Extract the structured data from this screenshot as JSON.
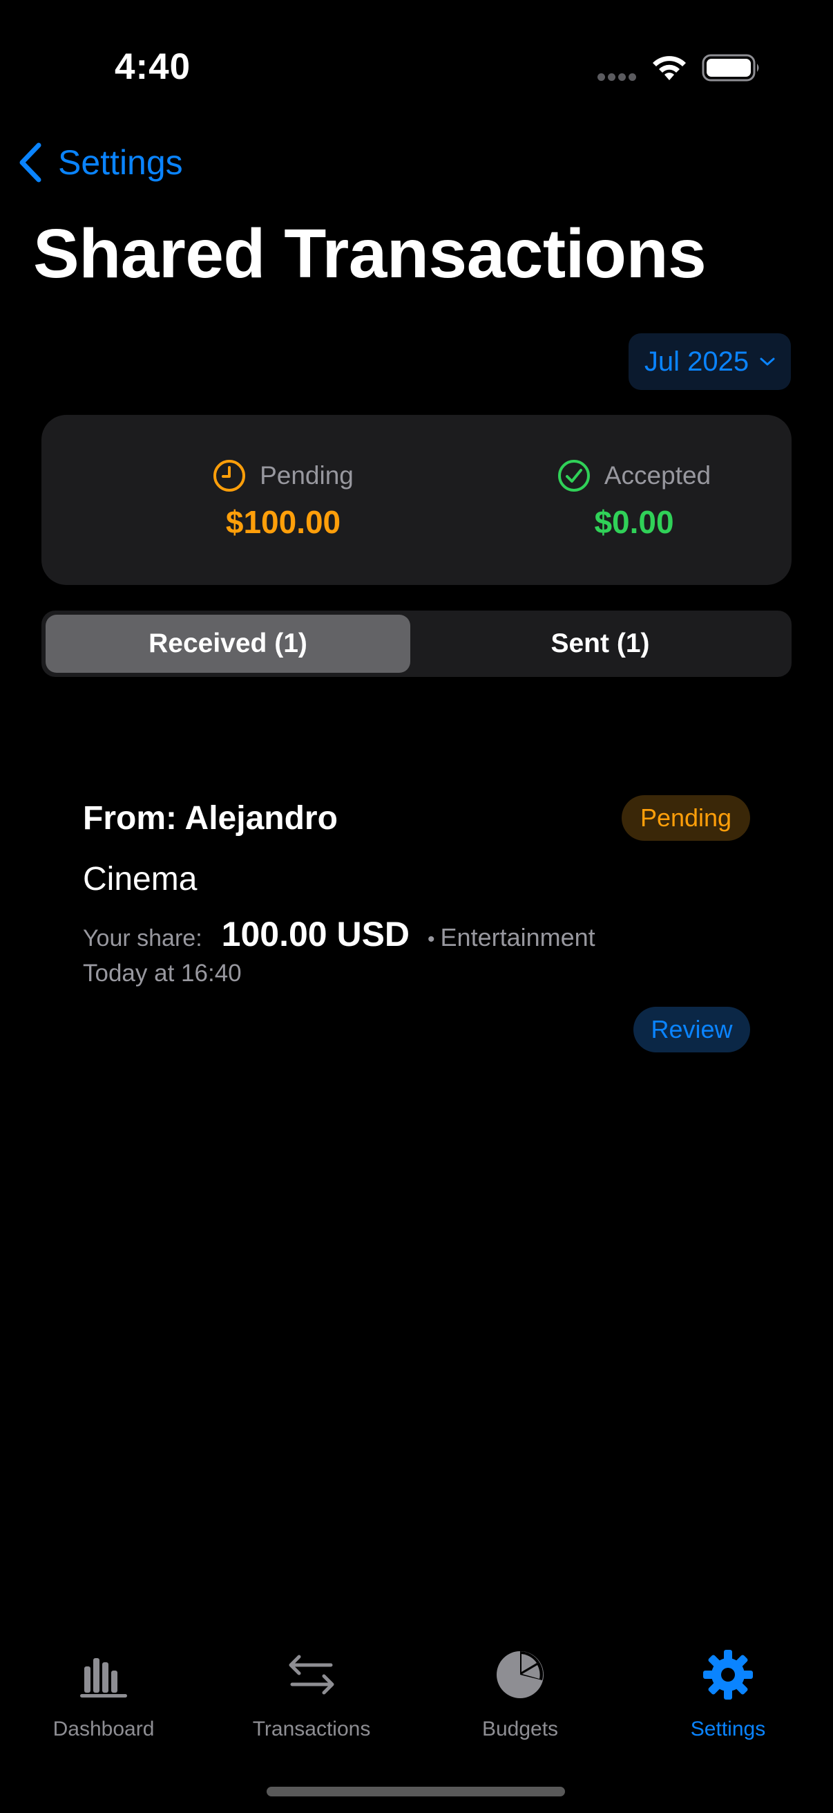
{
  "status_bar": {
    "time": "4:40"
  },
  "nav": {
    "back_label": "Settings",
    "title": "Shared Transactions"
  },
  "month_picker": {
    "label": "Jul 2025"
  },
  "summary": {
    "pending_label": "Pending",
    "pending_amount": "$100.00",
    "accepted_label": "Accepted",
    "accepted_amount": "$0.00"
  },
  "segments": {
    "received": "Received (1)",
    "sent": "Sent (1)",
    "selected": "received"
  },
  "transaction": {
    "from": "From: Alejandro",
    "status": "Pending",
    "title": "Cinema",
    "share_label": "Your share:",
    "share_amount": "100.00 USD",
    "separator": "•",
    "category": "Entertainment",
    "date": "Today at 16:40",
    "review_label": "Review"
  },
  "tab_bar": {
    "items": [
      {
        "label": "Dashboard",
        "icon": "chart-bar-icon"
      },
      {
        "label": "Transactions",
        "icon": "arrows-left-right-icon"
      },
      {
        "label": "Budgets",
        "icon": "pie-chart-icon"
      },
      {
        "label": "Settings",
        "icon": "gear-icon"
      }
    ],
    "active": "Settings"
  },
  "colors": {
    "accent": "#0a84ff",
    "pending": "#ff9f0a",
    "accepted": "#30d158",
    "card": "#1c1c1e"
  }
}
